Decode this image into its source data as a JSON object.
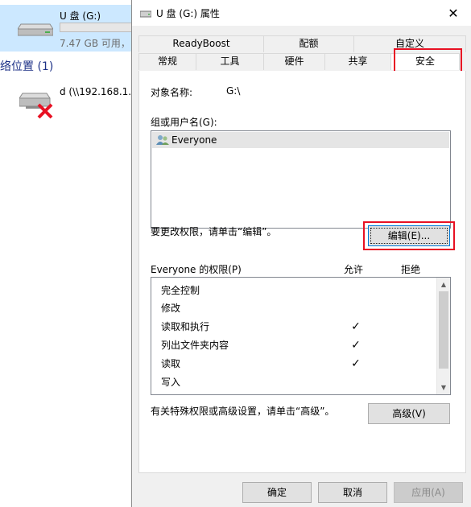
{
  "explorer": {
    "drive_name": "U 盘 (G:)",
    "drive_size": "7.47 GB 可用，",
    "network_header": "络位置 (1)",
    "network_drive": "d (\\\\192.168.1.1"
  },
  "dialog": {
    "title": "U 盘 (G:) 属性",
    "close_glyph": "✕",
    "tabs_row1": [
      "ReadyBoost",
      "配额",
      "自定义"
    ],
    "tabs_row2": [
      "常规",
      "工具",
      "硬件",
      "共享",
      "安全"
    ],
    "active_tab": "安全",
    "security": {
      "object_name_label": "对象名称:",
      "object_name_value": "G:\\",
      "group_label": "组或用户名(G):",
      "users": [
        "Everyone"
      ],
      "change_hint": "要更改权限，请单击“编辑”。",
      "edit_button": "编辑(E)...",
      "perm_label": "Everyone 的权限(P)",
      "allow_header": "允许",
      "deny_header": "拒绝",
      "permissions": [
        {
          "name": "完全控制",
          "allow": "",
          "deny": ""
        },
        {
          "name": "修改",
          "allow": "",
          "deny": ""
        },
        {
          "name": "读取和执行",
          "allow": "✓",
          "deny": ""
        },
        {
          "name": "列出文件夹内容",
          "allow": "✓",
          "deny": ""
        },
        {
          "name": "读取",
          "allow": "✓",
          "deny": ""
        },
        {
          "name": "写入",
          "allow": "",
          "deny": ""
        }
      ],
      "advanced_hint": "有关特殊权限或高级设置，请单击“高级”。",
      "advanced_button": "高级(V)"
    },
    "ok_button": "确定",
    "cancel_button": "取消",
    "apply_button": "应用(A)"
  },
  "colors": {
    "highlight": "#e81123",
    "selection": "#cce8ff",
    "focus": "#0078d7"
  }
}
